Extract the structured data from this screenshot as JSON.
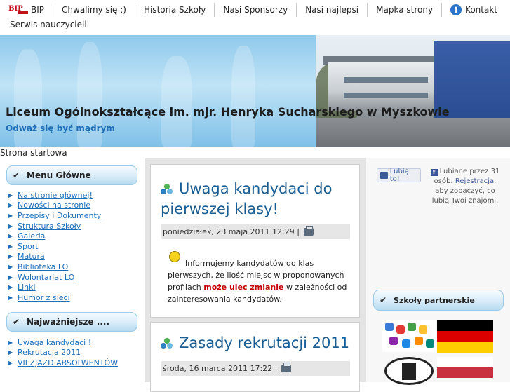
{
  "nav": {
    "items": [
      {
        "label": "BIP",
        "icon": "bip-logo"
      },
      {
        "label": "Chwalimy się :)"
      },
      {
        "label": "Historia Szkoły"
      },
      {
        "label": "Nasi Sponsorzy"
      },
      {
        "label": "Nasi najlepsi"
      },
      {
        "label": "Mapka strony"
      },
      {
        "label": "Kontakt",
        "icon": "info-icon"
      }
    ],
    "second_row": "Serwis nauczycieli"
  },
  "banner": {
    "title": "Liceum Ogólnokształcące im. mjr. Henryka Sucharskiego w Myszkowie",
    "subtitle": "Odważ się być mądrym"
  },
  "breadcrumb": "Strona startowa",
  "left": {
    "main_menu": {
      "title": "Menu Główne",
      "items": [
        "Na stronie głównej!",
        "Nowości na stronie",
        "Przepisy i Dokumenty",
        "Struktura Szkoły",
        "Galeria",
        "Sport",
        "Matura",
        "Biblioteka LO",
        "Wolontariat LO",
        "Linki",
        "Humor z sieci"
      ]
    },
    "important": {
      "title": "Najważniejsze ....",
      "items": [
        "Uwaga kandydaci !",
        "Rekrutacja 2011",
        "VII ZJAZD ABSOLWENTÓW"
      ]
    }
  },
  "articles": [
    {
      "title_line1": "Uwaga kandydaci do",
      "title_line2": "pierwszej klasy!",
      "meta": "poniedziałek, 23 maja 2011 12:29 |",
      "body_before": "Informujemy kandydatów do klas pierwszych, że ilość miejsc w proponowanych profilach ",
      "body_highlight": "może ulec zmianie",
      "body_after": " w zależności od zainteresowania kandydatów."
    },
    {
      "title_line1": "Zasady rekrutacji 2011",
      "meta": "środa, 16 marca 2011 17:22 |"
    }
  ],
  "right": {
    "like_label": "Lubię to!",
    "fb_text_before": "Lubiane przez 31 osób.",
    "fb_link": "Rejestracja",
    "fb_text_after": ", aby zobaczyć, co lubią Twoi znajomi.",
    "partners_title": "Szkoły partnerskie"
  }
}
